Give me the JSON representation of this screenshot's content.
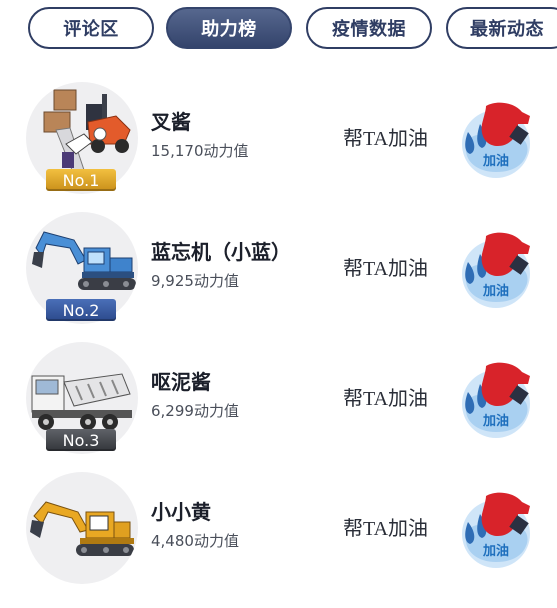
{
  "tabs": [
    {
      "label": "评论区",
      "active": false
    },
    {
      "label": "助力榜",
      "active": true
    },
    {
      "label": "疫情数据",
      "active": false
    },
    {
      "label": "最新动态",
      "active": false
    }
  ],
  "cheer_label": "帮TA加油",
  "cheer_icon_text": "加油",
  "ranking": [
    {
      "rank_badge": "No.1",
      "name": "叉酱",
      "power": "15,170动力值",
      "avatar_icon": "forklift-icon"
    },
    {
      "rank_badge": "No.2",
      "name": "蓝忘机（小蓝）",
      "power": "9,925动力值",
      "avatar_icon": "blue-excavator-icon"
    },
    {
      "rank_badge": "No.3",
      "name": "呕泥酱",
      "power": "6,299动力值",
      "avatar_icon": "cement-mixer-truck-icon"
    },
    {
      "rank_badge": "",
      "name": "小小黄",
      "power": "4,480动力值",
      "avatar_icon": "yellow-excavator-icon"
    }
  ],
  "colors": {
    "tab_border": "#2f3d63",
    "tab_active_bg": "#3e4e76",
    "rank1": "#d9a52b",
    "rank2": "#2f4f94",
    "rank3": "#3d4045",
    "cheer_blue": "#3d8fd9",
    "cheer_red": "#d8232a"
  }
}
